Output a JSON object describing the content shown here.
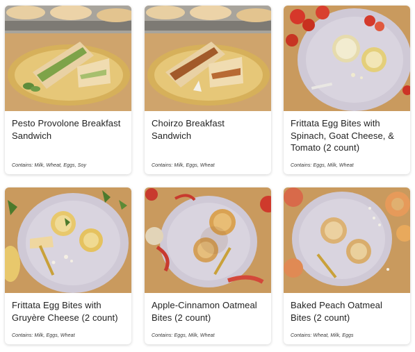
{
  "products": [
    {
      "title": "Pesto Provolone Breakfast Sandwich",
      "allergens": "Contains: Milk, Wheat, Eggs, Soy"
    },
    {
      "title": "Choirzo Breakfast Sandwich",
      "allergens": "Contains: Milk, Eggs, Wheat"
    },
    {
      "title": "Frittata Egg Bites with Spinach, Goat Cheese, & Tomato (2 count)",
      "allergens": "Contains: Eggs, Milk, Wheat"
    },
    {
      "title": "Frittata Egg Bites with Gruyère Cheese (2 count)",
      "allergens": "Contains: Milk, Eggs, Wheat"
    },
    {
      "title": "Apple-Cinnamon Oatmeal Bites (2 count)",
      "allergens": "Contains: Eggs, Milk, Wheat"
    },
    {
      "title": "Baked Peach Oatmeal Bites (2 count)",
      "allergens": "Contains: Wheat, Milk, Eggs"
    }
  ],
  "colors": {
    "card_bg": "#ffffff",
    "title_text": "#1f1f1f",
    "wood_table": "#c89a62",
    "plate_lavender": "#cfc9d6",
    "plate_yellow": "#d6b05a"
  }
}
